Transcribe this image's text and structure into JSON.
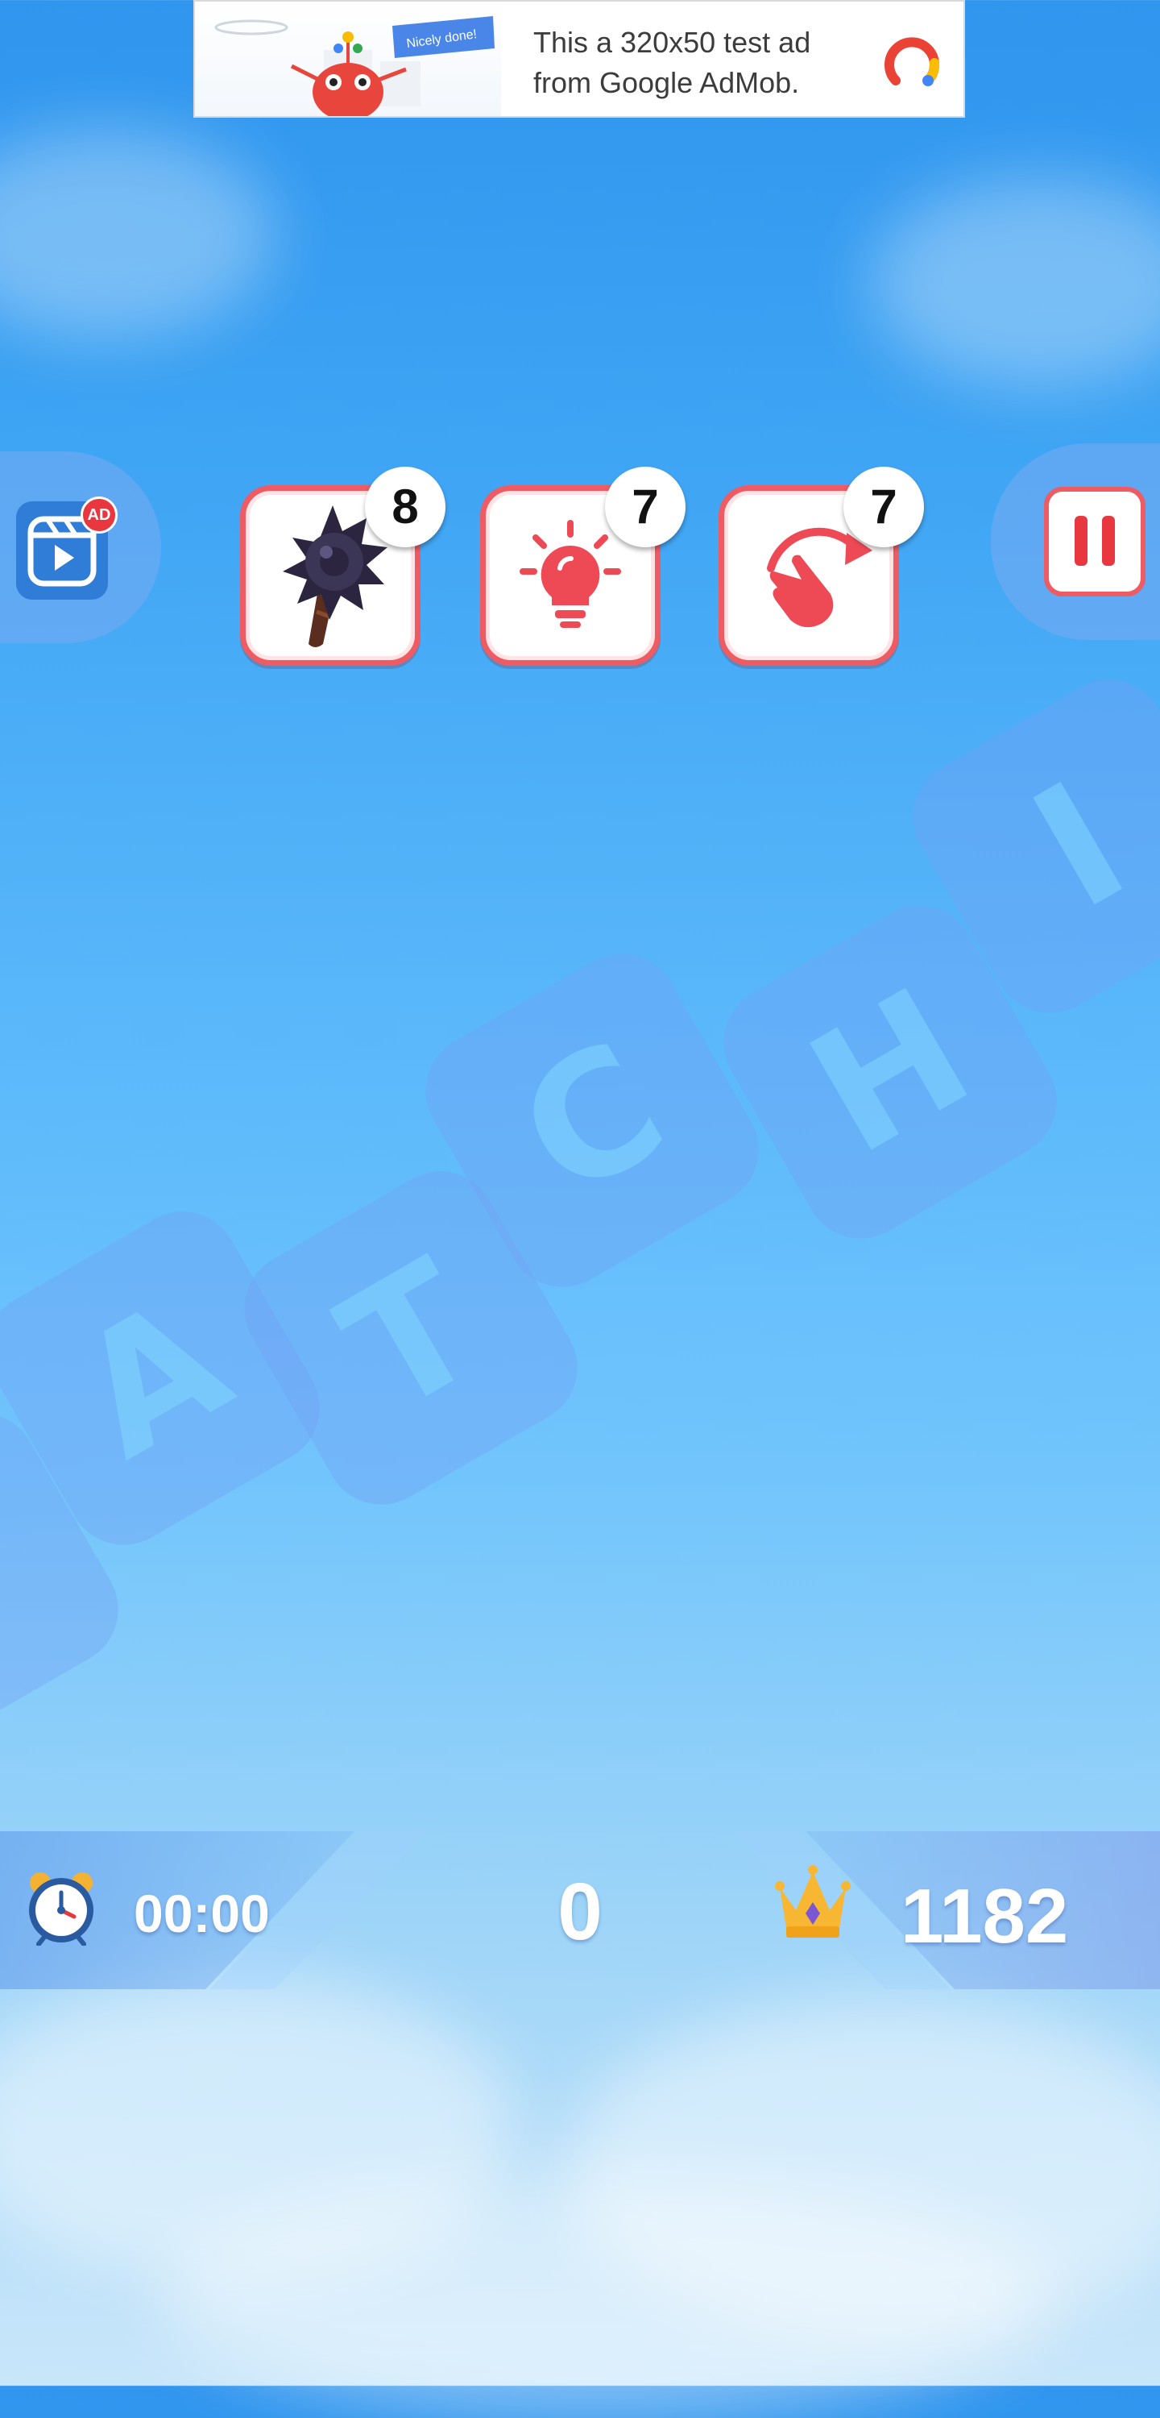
{
  "ad": {
    "text_line1": "This a 320x50 test ad",
    "text_line2": "from Google AdMob.",
    "flag_text": "Nicely done!"
  },
  "video_ad": {
    "badge": "AD"
  },
  "boosters": [
    {
      "name": "spiked-mace",
      "count": "8",
      "icon": "mace-icon"
    },
    {
      "name": "hint",
      "count": "7",
      "icon": "lightbulb-icon"
    },
    {
      "name": "undo",
      "count": "7",
      "icon": "undo-hand-icon"
    }
  ],
  "hud": {
    "timer": "00:00",
    "score": "0",
    "best_score": "1182"
  },
  "watermark": {
    "letters": [
      "A",
      "T",
      "C",
      "H",
      "I"
    ]
  },
  "colors": {
    "accent_red": "#ee5b62",
    "sky_top": "#2f95ee",
    "sky_bottom": "#c9e6fa"
  }
}
